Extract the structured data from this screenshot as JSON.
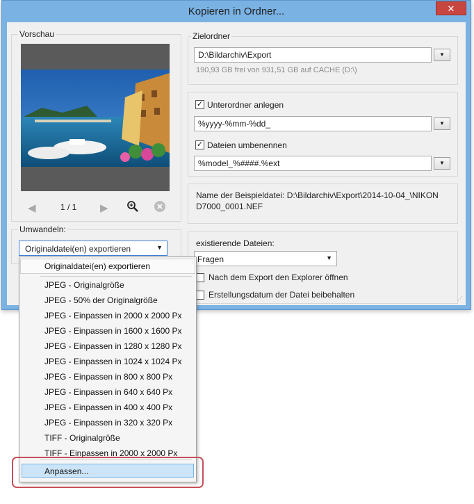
{
  "window": {
    "title": "Kopieren in Ordner...",
    "close_glyph": "✕"
  },
  "preview": {
    "group_label": "Vorschau",
    "page_indicator": "1 / 1"
  },
  "convert": {
    "group_label": "Umwandeln:",
    "selected": "Originaldatei(en) exportieren"
  },
  "target": {
    "group_label": "Zielordner",
    "path": "D:\\Bildarchiv\\Export",
    "free_space": "190,93 GB frei von 931,51 GB auf CACHE (D:\\)"
  },
  "options": {
    "subfolder_label": "Unterordner anlegen",
    "subfolder_checked": true,
    "subfolder_pattern": "%yyyy-%mm-%dd_",
    "rename_label": "Dateien umbenennen",
    "rename_checked": true,
    "rename_pattern": "%model_%####.%ext"
  },
  "example": {
    "line1": "Name der Beispieldatei: D:\\Bildarchiv\\Export\\2014-10-04_\\NIKON",
    "line2": "D7000_0001.NEF"
  },
  "existing": {
    "label": "existierende Dateien:",
    "selected": "Fragen",
    "open_explorer_label": "Nach dem Export den Explorer öffnen",
    "keep_date_label": "Erstellungsdatum der Datei beibehalten"
  },
  "menu": {
    "header_item": "Originaldatei(en) exportieren",
    "items": [
      "JPEG - Originalgröße",
      "JPEG - 50% der Originalgröße",
      "JPEG - Einpassen in 2000 x 2000 Px",
      "JPEG - Einpassen in 1600 x 1600 Px",
      "JPEG - Einpassen in 1280 x 1280 Px",
      "JPEG - Einpassen in 1024 x 1024 Px",
      "JPEG - Einpassen in 800 x 800 Px",
      "JPEG - Einpassen in 640 x 640 Px",
      "JPEG - Einpassen in 400 x 400 Px",
      "JPEG - Einpassen in 320 x 320 Px",
      "TIFF - Originalgröße",
      "TIFF - Einpassen in 2000 x 2000 Px"
    ],
    "custom_item": "Anpassen..."
  },
  "colors": {
    "title_bar": "#7ab2e4",
    "close_button": "#c7463f",
    "highlight_outline": "#c5505a",
    "menu_highlight": "#cce4f7"
  }
}
